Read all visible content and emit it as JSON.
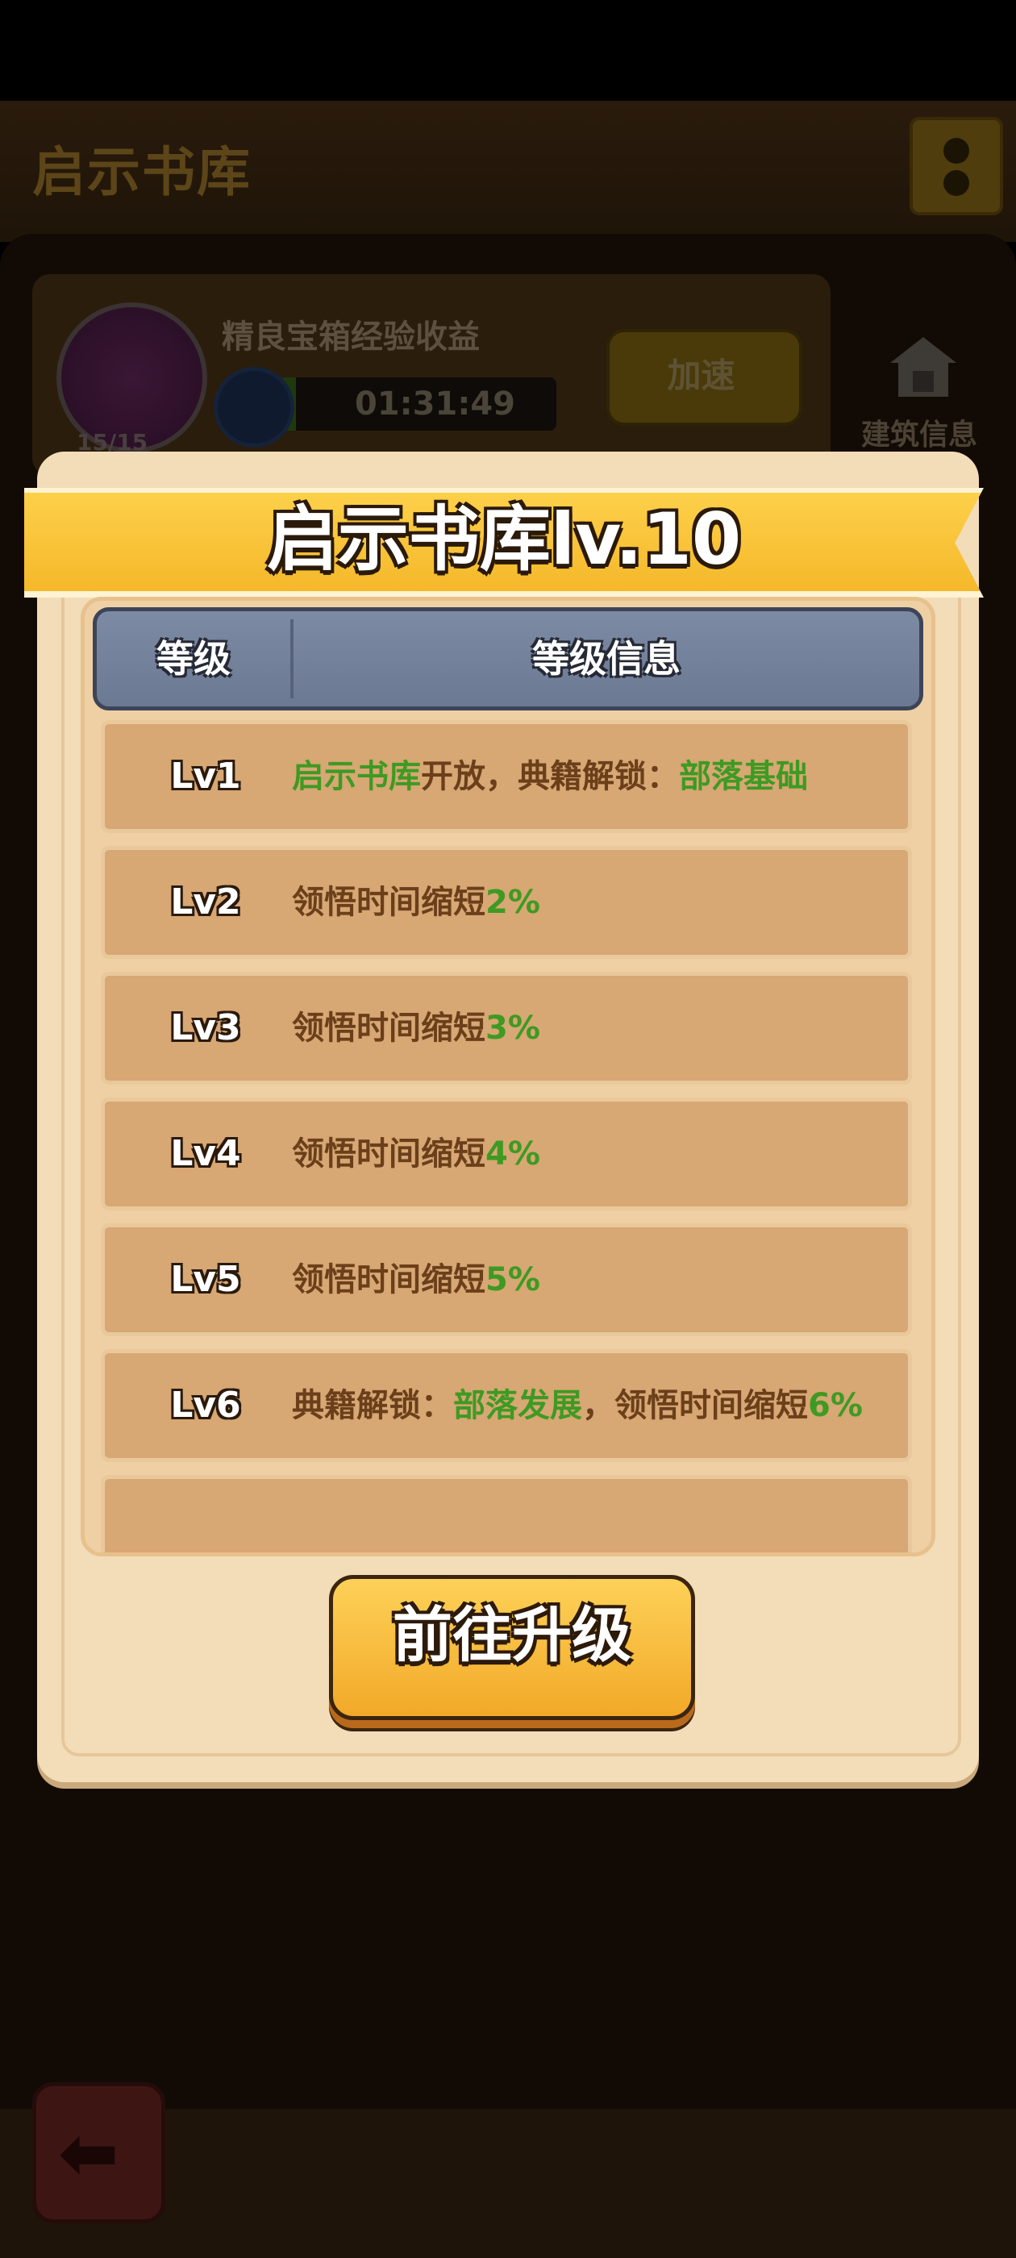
{
  "background": {
    "title": "启示书库",
    "reward_label": "精良宝箱经验收益",
    "timer": "01:31:49",
    "badge_count": "15/15",
    "speed_up_label": "加速",
    "building_info_label": "建筑信息"
  },
  "dialog": {
    "title": "启示书库lv.10",
    "table_header": {
      "level": "等级",
      "info": "等级信息"
    },
    "rows": [
      {
        "level": "Lv1",
        "parts": [
          {
            "t": "启示书库",
            "g": true
          },
          {
            "t": "开放，典籍解锁：",
            "g": false
          },
          {
            "t": "部落基础",
            "g": true
          }
        ]
      },
      {
        "level": "Lv2",
        "parts": [
          {
            "t": "领悟时间缩短",
            "g": false
          },
          {
            "t": "2%",
            "g": true
          }
        ]
      },
      {
        "level": "Lv3",
        "parts": [
          {
            "t": "领悟时间缩短",
            "g": false
          },
          {
            "t": "3%",
            "g": true
          }
        ]
      },
      {
        "level": "Lv4",
        "parts": [
          {
            "t": "领悟时间缩短",
            "g": false
          },
          {
            "t": "4%",
            "g": true
          }
        ]
      },
      {
        "level": "Lv5",
        "parts": [
          {
            "t": "领悟时间缩短",
            "g": false
          },
          {
            "t": "5%",
            "g": true
          }
        ]
      },
      {
        "level": "Lv6",
        "parts": [
          {
            "t": "典籍解锁：",
            "g": false
          },
          {
            "t": "部落发展",
            "g": true
          },
          {
            "t": "，领悟时间缩短",
            "g": false
          },
          {
            "t": "6%",
            "g": true
          }
        ]
      }
    ],
    "upgrade_button_label": "前往升级"
  },
  "colors": {
    "highlight_green": "#3e9a22",
    "text_brown": "#6b3f1a",
    "ribbon_yellow": "#fdd04a",
    "header_slate": "#7d8aa4"
  }
}
